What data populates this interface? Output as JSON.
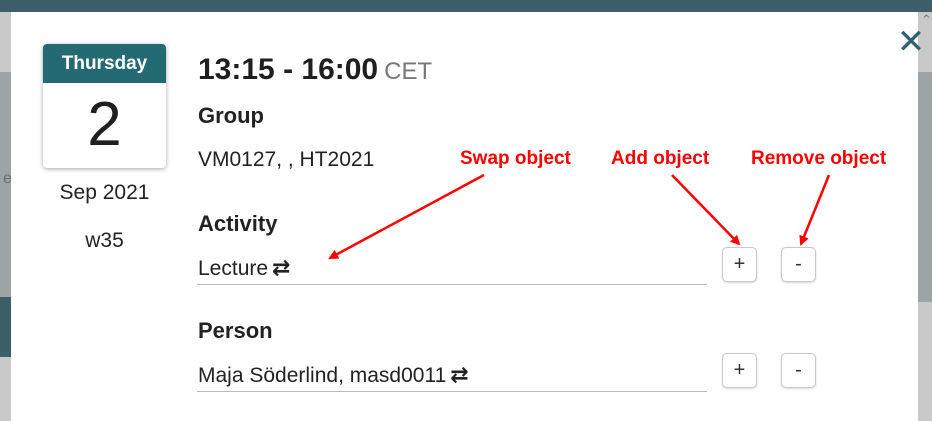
{
  "calendar": {
    "weekday": "Thursday",
    "day": "2",
    "month_year": "Sep 2021",
    "week": "w35"
  },
  "event": {
    "time": "13:15 - 16:00",
    "timezone": "CET"
  },
  "group": {
    "label": "Group",
    "value": "VM0127, , HT2021"
  },
  "activity": {
    "label": "Activity",
    "value": "Lecture",
    "add": "+",
    "remove": "-"
  },
  "person": {
    "label": "Person",
    "value": "Maja Söderlind, masd0011",
    "add": "+",
    "remove": "-"
  },
  "annotations": {
    "swap": "Swap object",
    "add": "Add object",
    "remove": "Remove object",
    "color": "#ff0000"
  },
  "icons": {
    "close": "close-icon",
    "swap": "swap-icon",
    "scroll_up": "chevron-up-icon"
  },
  "backdrop": {
    "partial_text": "e"
  },
  "colors": {
    "calendar_header": "#246a73",
    "topbar": "#3d5f6a",
    "close_icon": "#2f6271"
  }
}
